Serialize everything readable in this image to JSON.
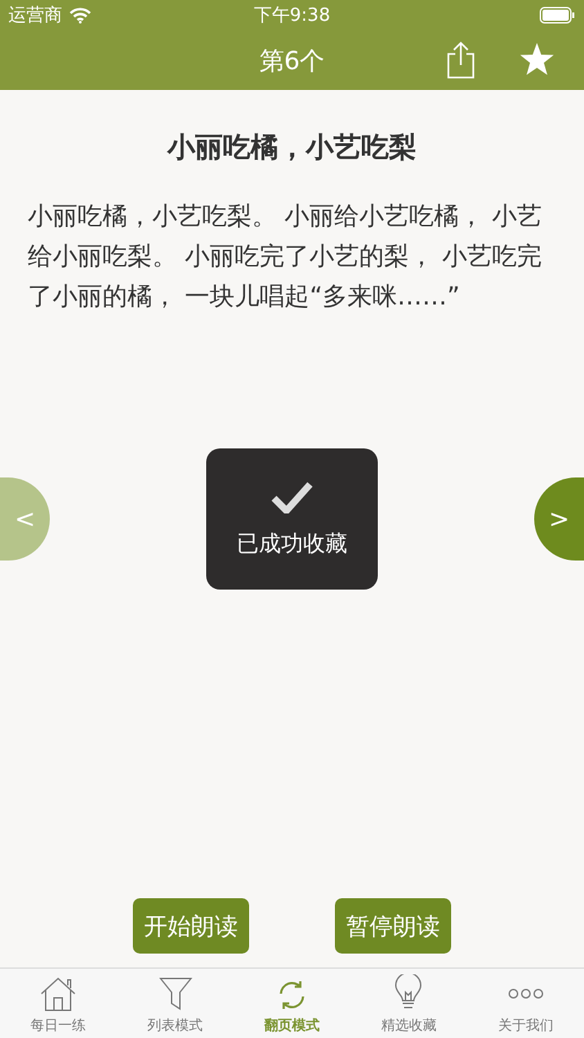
{
  "status_bar": {
    "carrier": "运营商",
    "time": "下午9:38"
  },
  "nav": {
    "title": "第6个"
  },
  "article": {
    "title": "小丽吃橘，小艺吃梨",
    "body": "小丽吃橘，小艺吃梨。 小丽给小艺吃橘， 小艺给小丽吃梨。 小丽吃完了小艺的梨， 小艺吃完了小丽的橘， 一块儿唱起“多来咪……”"
  },
  "prev_button": "<",
  "next_button": ">",
  "toast": {
    "message": "已成功收藏"
  },
  "buttons": [
    "开始朗读",
    "暂停朗读"
  ],
  "tabs": [
    {
      "label": "每日一练",
      "selected": false
    },
    {
      "label": "列表模式",
      "selected": false
    },
    {
      "label": "翻页模式",
      "selected": true
    },
    {
      "label": "精选收藏",
      "selected": false
    },
    {
      "label": "关于我们",
      "selected": false
    }
  ]
}
